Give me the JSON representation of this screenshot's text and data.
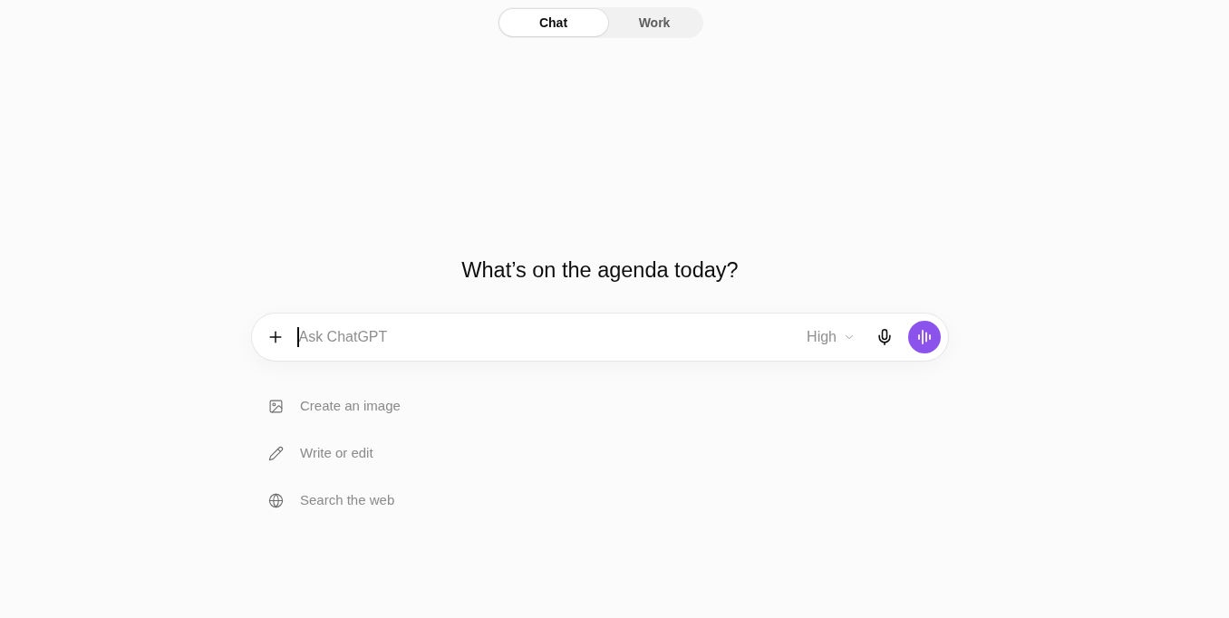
{
  "mode_tabs": [
    {
      "label": "Chat",
      "selected": true
    },
    {
      "label": "Work",
      "selected": false
    }
  ],
  "heading": "What’s on the agenda today?",
  "composer": {
    "placeholder": "Ask ChatGPT",
    "model": "High"
  },
  "suggestions": [
    {
      "kind": "image",
      "label": "Create an image"
    },
    {
      "kind": "pencil",
      "label": "Write or edit"
    },
    {
      "kind": "globe",
      "label": "Search the web"
    }
  ]
}
